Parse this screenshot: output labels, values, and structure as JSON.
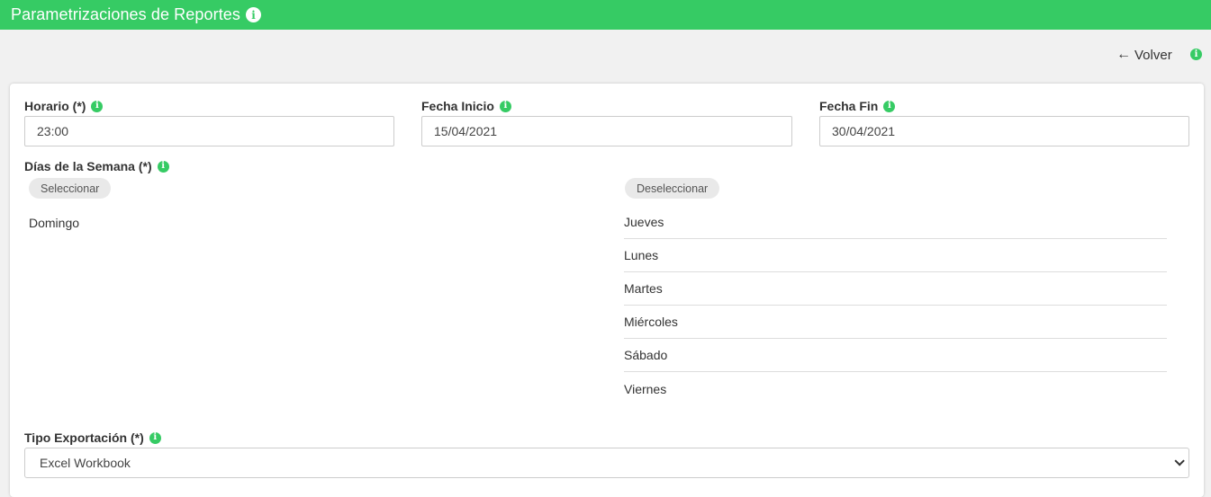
{
  "header": {
    "title": "Parametrizaciones de Reportes",
    "info_icon": "info-circle-icon"
  },
  "nav": {
    "back_label": "Volver",
    "back_icon": "arrow-left-icon"
  },
  "form": {
    "horario": {
      "label": "Horario (*)",
      "value": "23:00"
    },
    "fecha_inicio": {
      "label": "Fecha Inicio",
      "value": "15/04/2021"
    },
    "fecha_fin": {
      "label": "Fecha Fin",
      "value": "30/04/2021"
    },
    "dias": {
      "label": "Días de la Semana (*)",
      "select_button": "Seleccionar",
      "deselect_button": "Deseleccionar",
      "available": [
        "Domingo"
      ],
      "selected": [
        "Jueves",
        "Lunes",
        "Martes",
        "Miércoles",
        "Sábado",
        "Viernes"
      ]
    },
    "tipo_exportacion": {
      "label": "Tipo Exportación (*)",
      "value": "Excel Workbook"
    }
  },
  "colors": {
    "brand_green": "#36cb64",
    "page_bg": "#f1f1f1"
  }
}
